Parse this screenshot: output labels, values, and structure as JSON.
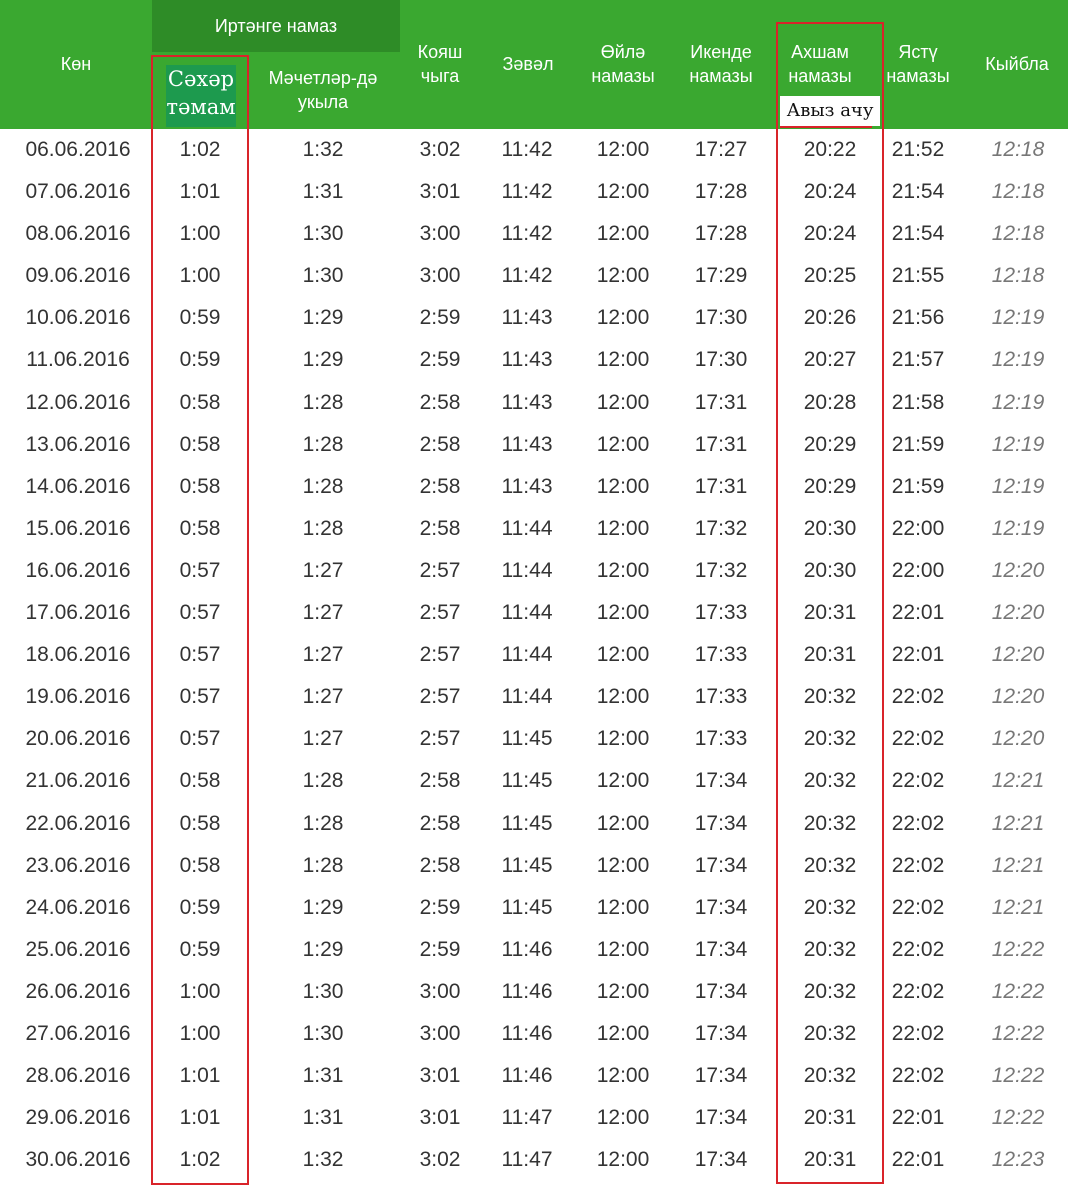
{
  "header": {
    "group_title": "Иртәнге намаз",
    "date": "Көн",
    "suhur": "Сәхәр\nтәмам",
    "mosque": "Мәчетләр-дә\nукыла",
    "sunrise": "Кояш\nчыга",
    "zawal": "Зәвәл",
    "dhuhr": "Өйлә\nнамазы",
    "asr": "Икенде\nнамазы",
    "maghrib": "Ахшам\nнамазы",
    "iftar": "Авыз ачу",
    "isha": "Ястү\nнамазы",
    "qibla": "Кыйбла"
  },
  "rows": [
    {
      "date": "06.06.2016",
      "suhur": "1:02",
      "mosque": "1:32",
      "sunrise": "3:02",
      "zawal": "11:42",
      "dhuhr": "12:00",
      "asr": "17:27",
      "maghrib": "20:22",
      "isha": "21:52",
      "qibla": "12:18"
    },
    {
      "date": "07.06.2016",
      "suhur": "1:01",
      "mosque": "1:31",
      "sunrise": "3:01",
      "zawal": "11:42",
      "dhuhr": "12:00",
      "asr": "17:28",
      "maghrib": "20:24",
      "isha": "21:54",
      "qibla": "12:18"
    },
    {
      "date": "08.06.2016",
      "suhur": "1:00",
      "mosque": "1:30",
      "sunrise": "3:00",
      "zawal": "11:42",
      "dhuhr": "12:00",
      "asr": "17:28",
      "maghrib": "20:24",
      "isha": "21:54",
      "qibla": "12:18"
    },
    {
      "date": "09.06.2016",
      "suhur": "1:00",
      "mosque": "1:30",
      "sunrise": "3:00",
      "zawal": "11:42",
      "dhuhr": "12:00",
      "asr": "17:29",
      "maghrib": "20:25",
      "isha": "21:55",
      "qibla": "12:18"
    },
    {
      "date": "10.06.2016",
      "suhur": "0:59",
      "mosque": "1:29",
      "sunrise": "2:59",
      "zawal": "11:43",
      "dhuhr": "12:00",
      "asr": "17:30",
      "maghrib": "20:26",
      "isha": "21:56",
      "qibla": "12:19"
    },
    {
      "date": "11.06.2016",
      "suhur": "0:59",
      "mosque": "1:29",
      "sunrise": "2:59",
      "zawal": "11:43",
      "dhuhr": "12:00",
      "asr": "17:30",
      "maghrib": "20:27",
      "isha": "21:57",
      "qibla": "12:19"
    },
    {
      "date": "12.06.2016",
      "suhur": "0:58",
      "mosque": "1:28",
      "sunrise": "2:58",
      "zawal": "11:43",
      "dhuhr": "12:00",
      "asr": "17:31",
      "maghrib": "20:28",
      "isha": "21:58",
      "qibla": "12:19"
    },
    {
      "date": "13.06.2016",
      "suhur": "0:58",
      "mosque": "1:28",
      "sunrise": "2:58",
      "zawal": "11:43",
      "dhuhr": "12:00",
      "asr": "17:31",
      "maghrib": "20:29",
      "isha": "21:59",
      "qibla": "12:19"
    },
    {
      "date": "14.06.2016",
      "suhur": "0:58",
      "mosque": "1:28",
      "sunrise": "2:58",
      "zawal": "11:43",
      "dhuhr": "12:00",
      "asr": "17:31",
      "maghrib": "20:29",
      "isha": "21:59",
      "qibla": "12:19"
    },
    {
      "date": "15.06.2016",
      "suhur": "0:58",
      "mosque": "1:28",
      "sunrise": "2:58",
      "zawal": "11:44",
      "dhuhr": "12:00",
      "asr": "17:32",
      "maghrib": "20:30",
      "isha": "22:00",
      "qibla": "12:19"
    },
    {
      "date": "16.06.2016",
      "suhur": "0:57",
      "mosque": "1:27",
      "sunrise": "2:57",
      "zawal": "11:44",
      "dhuhr": "12:00",
      "asr": "17:32",
      "maghrib": "20:30",
      "isha": "22:00",
      "qibla": "12:20"
    },
    {
      "date": "17.06.2016",
      "suhur": "0:57",
      "mosque": "1:27",
      "sunrise": "2:57",
      "zawal": "11:44",
      "dhuhr": "12:00",
      "asr": "17:33",
      "maghrib": "20:31",
      "isha": "22:01",
      "qibla": "12:20"
    },
    {
      "date": "18.06.2016",
      "suhur": "0:57",
      "mosque": "1:27",
      "sunrise": "2:57",
      "zawal": "11:44",
      "dhuhr": "12:00",
      "asr": "17:33",
      "maghrib": "20:31",
      "isha": "22:01",
      "qibla": "12:20"
    },
    {
      "date": "19.06.2016",
      "suhur": "0:57",
      "mosque": "1:27",
      "sunrise": "2:57",
      "zawal": "11:44",
      "dhuhr": "12:00",
      "asr": "17:33",
      "maghrib": "20:32",
      "isha": "22:02",
      "qibla": "12:20"
    },
    {
      "date": "20.06.2016",
      "suhur": "0:57",
      "mosque": "1:27",
      "sunrise": "2:57",
      "zawal": "11:45",
      "dhuhr": "12:00",
      "asr": "17:33",
      "maghrib": "20:32",
      "isha": "22:02",
      "qibla": "12:20"
    },
    {
      "date": "21.06.2016",
      "suhur": "0:58",
      "mosque": "1:28",
      "sunrise": "2:58",
      "zawal": "11:45",
      "dhuhr": "12:00",
      "asr": "17:34",
      "maghrib": "20:32",
      "isha": "22:02",
      "qibla": "12:21"
    },
    {
      "date": "22.06.2016",
      "suhur": "0:58",
      "mosque": "1:28",
      "sunrise": "2:58",
      "zawal": "11:45",
      "dhuhr": "12:00",
      "asr": "17:34",
      "maghrib": "20:32",
      "isha": "22:02",
      "qibla": "12:21"
    },
    {
      "date": "23.06.2016",
      "suhur": "0:58",
      "mosque": "1:28",
      "sunrise": "2:58",
      "zawal": "11:45",
      "dhuhr": "12:00",
      "asr": "17:34",
      "maghrib": "20:32",
      "isha": "22:02",
      "qibla": "12:21"
    },
    {
      "date": "24.06.2016",
      "suhur": "0:59",
      "mosque": "1:29",
      "sunrise": "2:59",
      "zawal": "11:45",
      "dhuhr": "12:00",
      "asr": "17:34",
      "maghrib": "20:32",
      "isha": "22:02",
      "qibla": "12:21"
    },
    {
      "date": "25.06.2016",
      "suhur": "0:59",
      "mosque": "1:29",
      "sunrise": "2:59",
      "zawal": "11:46",
      "dhuhr": "12:00",
      "asr": "17:34",
      "maghrib": "20:32",
      "isha": "22:02",
      "qibla": "12:22"
    },
    {
      "date": "26.06.2016",
      "suhur": "1:00",
      "mosque": "1:30",
      "sunrise": "3:00",
      "zawal": "11:46",
      "dhuhr": "12:00",
      "asr": "17:34",
      "maghrib": "20:32",
      "isha": "22:02",
      "qibla": "12:22"
    },
    {
      "date": "27.06.2016",
      "suhur": "1:00",
      "mosque": "1:30",
      "sunrise": "3:00",
      "zawal": "11:46",
      "dhuhr": "12:00",
      "asr": "17:34",
      "maghrib": "20:32",
      "isha": "22:02",
      "qibla": "12:22"
    },
    {
      "date": "28.06.2016",
      "suhur": "1:01",
      "mosque": "1:31",
      "sunrise": "3:01",
      "zawal": "11:46",
      "dhuhr": "12:00",
      "asr": "17:34",
      "maghrib": "20:32",
      "isha": "22:02",
      "qibla": "12:22"
    },
    {
      "date": "29.06.2016",
      "suhur": "1:01",
      "mosque": "1:31",
      "sunrise": "3:01",
      "zawal": "11:47",
      "dhuhr": "12:00",
      "asr": "17:34",
      "maghrib": "20:31",
      "isha": "22:01",
      "qibla": "12:22"
    },
    {
      "date": "30.06.2016",
      "suhur": "1:02",
      "mosque": "1:32",
      "sunrise": "3:02",
      "zawal": "11:47",
      "dhuhr": "12:00",
      "asr": "17:34",
      "maghrib": "20:31",
      "isha": "22:01",
      "qibla": "12:23"
    }
  ],
  "colors": {
    "header_green": "#3aa830",
    "group_green": "#2e8c27",
    "highlight_red": "#d9242a",
    "text": "#333333"
  }
}
